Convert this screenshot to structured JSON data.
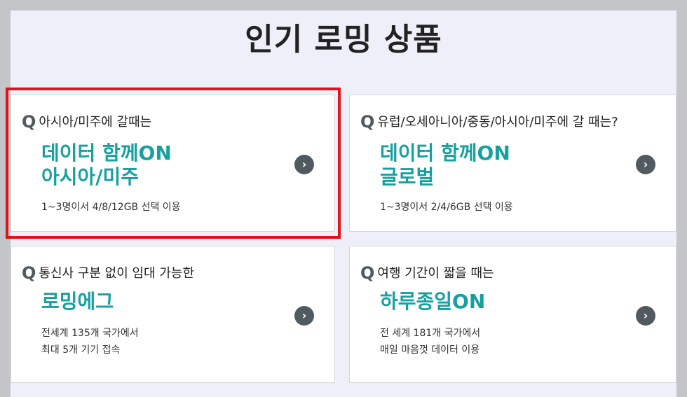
{
  "title": "인기 로밍 상품",
  "q_mark": "Q",
  "arrow_glyph": "›",
  "cards": [
    {
      "question": "아시아/미주에 갈때는",
      "name_lines": [
        "데이터 함께ON",
        "아시아/미주"
      ],
      "desc_lines": [
        "1~3명이서 4/8/12GB 선택 이용"
      ],
      "selected": true
    },
    {
      "question": "유럽/오세아니아/중동/아시아/미주에 갈 때는?",
      "name_lines": [
        "데이터 함께ON",
        "글로벌"
      ],
      "desc_lines": [
        "1~3명이서 2/4/6GB 선택 이용"
      ]
    },
    {
      "question": "통신사 구분 없이 임대 가능한",
      "name_lines": [
        "로밍에그"
      ],
      "desc_lines": [
        "전세계 135개 국가에서",
        "최대 5개 기기 접속"
      ]
    },
    {
      "question": "여행 기간이 짧을 때는",
      "name_lines": [
        "하루종일ON"
      ],
      "desc_lines": [
        "전 세계 181개 국가에서",
        "매일 마음껏 데이터 이용"
      ]
    }
  ],
  "colors": {
    "accent": "#16a0a0",
    "highlight": "#e0131b",
    "background": "#eeeff9",
    "frame": "#c4c5c9"
  }
}
